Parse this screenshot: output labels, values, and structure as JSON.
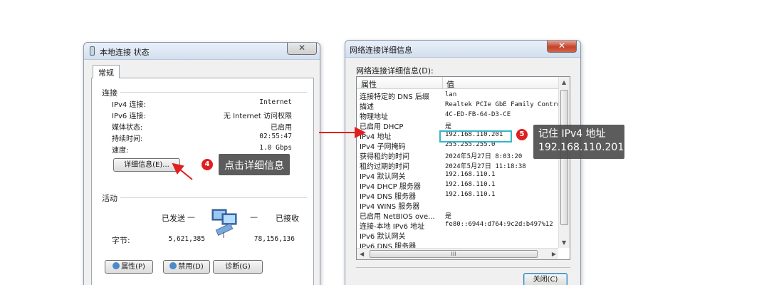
{
  "status_window": {
    "title": "本地连接 状态",
    "close_icon": "close-icon",
    "tab_general": "常规",
    "connection_group": "连接",
    "rows": [
      {
        "label": "IPv4 连接:",
        "value": "Internet"
      },
      {
        "label": "IPv6 连接:",
        "value": "无 Internet 访问权限"
      },
      {
        "label": "媒体状态:",
        "value": "已启用"
      },
      {
        "label": "持续时间:",
        "value": "02:55:47"
      },
      {
        "label": "速度:",
        "value": "1.0 Gbps"
      }
    ],
    "details_button": "详细信息(E)...",
    "activity_group": "活动",
    "sent_label": "已发送",
    "received_label": "已接收",
    "dash": "—",
    "bytes_label": "字节:",
    "bytes_sent": "5,621,385",
    "bytes_received": "78,156,136",
    "properties_button": "属性(P)",
    "disable_button": "禁用(D)",
    "diagnose_button": "诊断(G)"
  },
  "details_window": {
    "title": "网络连接详细信息",
    "close_icon": "close-icon",
    "group_label": "网络连接详细信息(D):",
    "col_property": "属性",
    "col_value": "值",
    "rows": [
      {
        "property": "连接特定的 DNS 后缀",
        "value": "lan"
      },
      {
        "property": "描述",
        "value": "Realtek PCIe GbE Family Contro"
      },
      {
        "property": "物理地址",
        "value": "4C-ED-FB-64-D3-CE"
      },
      {
        "property": "已启用 DHCP",
        "value": "是"
      },
      {
        "property": "IPv4 地址",
        "value": "192.168.110.201"
      },
      {
        "property": "IPv4 子网掩码",
        "value": "255.255.255.0"
      },
      {
        "property": "获得租约的时间",
        "value": "2024年5月27日 8:03:20"
      },
      {
        "property": "租约过期的时间",
        "value": "2024年5月27日 11:18:38"
      },
      {
        "property": "IPv4 默认网关",
        "value": "192.168.110.1"
      },
      {
        "property": "IPv4 DHCP 服务器",
        "value": "192.168.110.1"
      },
      {
        "property": "IPv4 DNS 服务器",
        "value": "192.168.110.1"
      },
      {
        "property": "IPv4 WINS 服务器",
        "value": ""
      },
      {
        "property": "已启用 NetBIOS ove...",
        "value": "是"
      },
      {
        "property": "连接-本地 IPv6 地址",
        "value": "fe80::6944:d764:9c2d:b497%12"
      },
      {
        "property": "IPv6 默认网关",
        "value": ""
      },
      {
        "property": "IPv6 DNS 服务器",
        "value": ""
      }
    ],
    "scroll_grip": "III",
    "close_button": "关闭(C)"
  },
  "annotations": {
    "step4_number": "4",
    "step4_text": "点击详细信息",
    "step5_number": "5",
    "step5_line1": "记住 IPv4 地址",
    "step5_line2": "192.168.110.201"
  },
  "colors": {
    "highlight_box": "#33b6c7",
    "callout_bg": "#464646",
    "badge": "#e02020",
    "arrow": "#e02020"
  }
}
